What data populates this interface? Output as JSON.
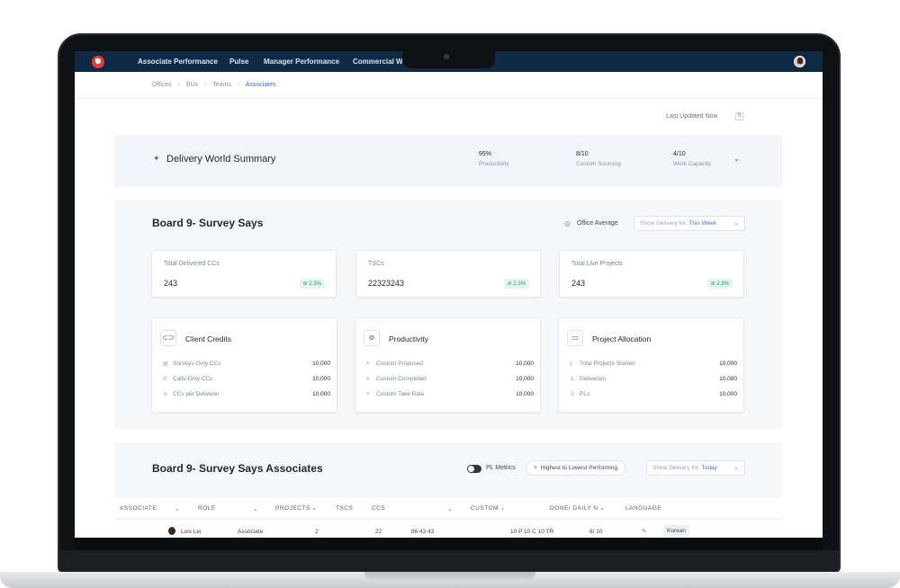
{
  "nav": {
    "items": [
      "Associate Performance",
      "Pulse",
      "Manager Performance",
      "Commercial Wo"
    ]
  },
  "breadcrumb": [
    "Offices",
    "BUs",
    "Teams",
    "Associates"
  ],
  "last_updated": "Last Updated Now",
  "summary": {
    "title": "Delivery World Summary",
    "metrics": [
      {
        "value": "95%",
        "label": "Productivity"
      },
      {
        "value": "8/10",
        "label": "Custom Sourcing"
      },
      {
        "value": "4/10",
        "label": "Work Capacity"
      }
    ]
  },
  "board": {
    "title": "Board 9- Survey Says",
    "office_average": "Office Average",
    "show_delivery_prefix": "Show Delivery for:",
    "show_delivery_value": "This Week",
    "stats": [
      {
        "label": "Total Delivered CCs",
        "value": "243",
        "change": "2.3%"
      },
      {
        "label": "TSCs",
        "value": "22323243",
        "change": "2.3%"
      },
      {
        "label": "Total Live Projects",
        "value": "243",
        "change": "2.3%"
      }
    ],
    "cards": [
      {
        "title": "Client Credits",
        "icon": "credits-icon",
        "rows": [
          {
            "label": "Surveys-Only CCs",
            "value": "10,000"
          },
          {
            "label": "Calls-Only CCs",
            "value": "10,000"
          },
          {
            "label": "CCs per Deliverer",
            "value": "10,000"
          }
        ]
      },
      {
        "title": "Productivity",
        "icon": "productivity-icon",
        "rows": [
          {
            "label": "Custom Proposed",
            "value": "10,000"
          },
          {
            "label": "Custom Completed",
            "value": "10,000"
          },
          {
            "label": "Custom Take Rate",
            "value": "10,000"
          }
        ]
      },
      {
        "title": "Project Allocation",
        "icon": "project-icon",
        "rows": [
          {
            "label": "Total Projects Started",
            "value": "10,000"
          },
          {
            "label": "Deliverers",
            "value": "10,000"
          },
          {
            "label": "PLs",
            "value": "10,000"
          }
        ]
      }
    ]
  },
  "associates": {
    "title": "Board 9- Survey Says Associates",
    "pl_metrics": "PL Metrics",
    "sort_label": "Highest to Lowest Performing",
    "show_delivery_prefix": "Show Delivery for:",
    "show_delivery_value": "Today",
    "columns": [
      "ASSOCIATE",
      "ROLE",
      "PROJECTS",
      "TSCS",
      "CCS",
      "CUSTOM",
      "DONE/ DAILY N",
      "LANGUAGE"
    ],
    "rows": [
      {
        "name": "Lois Lei",
        "role": "Associate",
        "projects": "2",
        "tscs": "22",
        "ccs": "86   43   43",
        "custom": "10 P   10 C   10 TR",
        "done": "8/ 10",
        "language": "Korean"
      }
    ]
  },
  "colors": {
    "nav_bg": "#0f2a45",
    "accent": "#3f6fd1",
    "positive": "#21995d",
    "brand": "#e23b3b"
  }
}
